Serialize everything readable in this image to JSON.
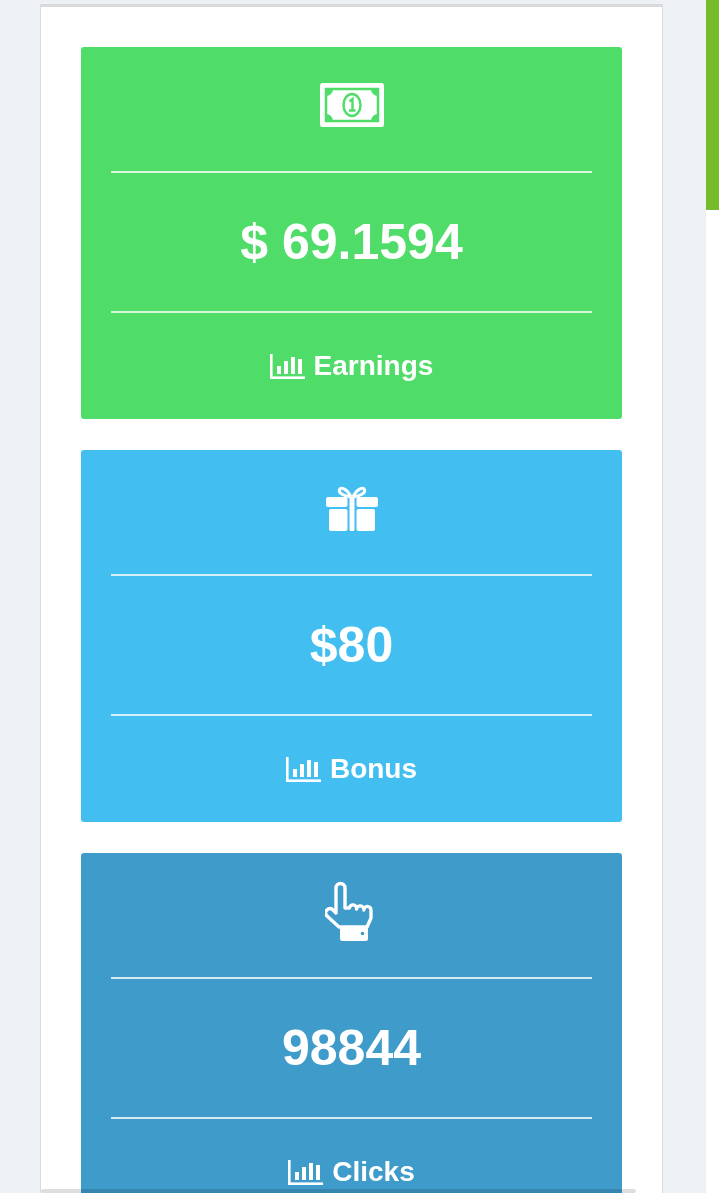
{
  "cards": [
    {
      "kind": "money",
      "color": "#50dc68",
      "value": "$ 69.1594",
      "label": "Earnings"
    },
    {
      "kind": "gift",
      "color": "#42bff0",
      "value": "$80",
      "label": "Bonus"
    },
    {
      "kind": "pointer",
      "color": "#3f9bca",
      "value": "98844",
      "label": "Clicks"
    }
  ]
}
